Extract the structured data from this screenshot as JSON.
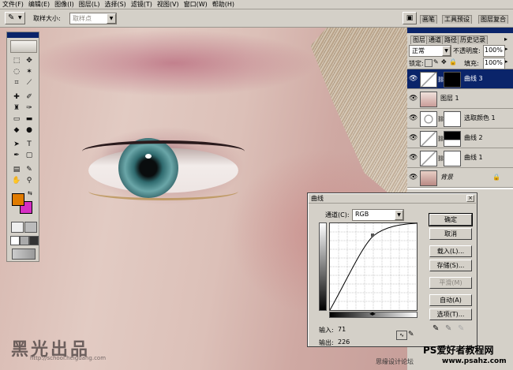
{
  "menubar": {
    "items": [
      "文件(F)",
      "编辑(E)",
      "图像(I)",
      "图层(L)",
      "选择(S)",
      "滤镜(T)",
      "视图(V)",
      "窗口(W)",
      "帮助(H)"
    ]
  },
  "options_bar": {
    "sample_size_label": "取样大小:",
    "sample_size_value": "取样点",
    "palette_tabs": [
      "画笔",
      "工具预设",
      "图层复合"
    ]
  },
  "canvas": {
    "watermark": "黑光出品",
    "watermark_url": "http://school.heiguang.com"
  },
  "layers_panel": {
    "tabs": [
      "图层",
      "通道",
      "路径",
      "历史记录"
    ],
    "blend_mode": "正常",
    "opacity_label": "不透明度:",
    "opacity_value": "100%",
    "lock_label": "锁定:",
    "fill_label": "填充:",
    "fill_value": "100%",
    "layers": [
      {
        "name": "曲线 3",
        "selected": true
      },
      {
        "name": "图层 1",
        "selected": false
      },
      {
        "name": "选取颜色 1",
        "selected": false
      },
      {
        "name": "曲线 2",
        "selected": false
      },
      {
        "name": "曲线 1",
        "selected": false
      },
      {
        "name": "背景",
        "selected": false
      }
    ]
  },
  "curves_dialog": {
    "title": "曲线",
    "channel_label": "通道(C):",
    "channel_value": "RGB",
    "input_label": "输入:",
    "input_value": "71",
    "output_label": "输出:",
    "output_value": "226",
    "buttons": {
      "ok": "确定",
      "cancel": "取消",
      "load": "载入(L)...",
      "save": "存储(S)...",
      "smooth": "平滑(M)",
      "auto": "自动(A)",
      "options": "选项(T)..."
    }
  },
  "footer": {
    "site_cn": "PS爱好者教程网",
    "site_url": "www.psahz.com",
    "forum_text": "思缘设计论坛"
  },
  "colors": {
    "foreground": "#e07b00",
    "background": "#d62fc4",
    "selection": "#0a246a"
  }
}
